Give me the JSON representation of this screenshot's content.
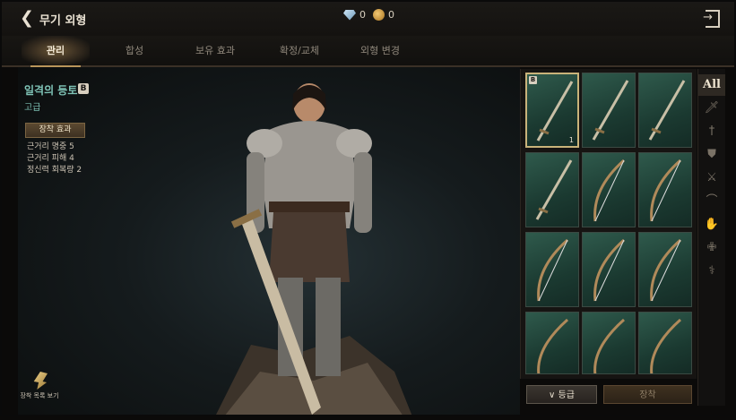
{
  "header": {
    "back_icon": "chevron-left-icon",
    "title": "무기 외형",
    "gem_count": "0",
    "coin_count": "0",
    "exit_icon": "exit-icon"
  },
  "tabs": [
    {
      "label": "관리",
      "active": true
    },
    {
      "label": "합성",
      "active": false
    },
    {
      "label": "보유 효과",
      "active": false
    },
    {
      "label": "확정/교체",
      "active": false
    },
    {
      "label": "외형 변경",
      "active": false
    }
  ],
  "item": {
    "name": "일격의 등토",
    "grade_badge": "B",
    "grade": "고급",
    "equip_effect_label": "장착 효과",
    "stats": [
      "근거리 명중 5",
      "근거리 피해 4",
      "정신력 회복량 2"
    ]
  },
  "gallery": {
    "label": "장착 목록 보기"
  },
  "grid": {
    "slots": [
      {
        "weapon": "sword",
        "selected": true,
        "badge": "B",
        "count": "1"
      },
      {
        "weapon": "sword",
        "selected": false
      },
      {
        "weapon": "sword",
        "selected": false
      },
      {
        "weapon": "sword",
        "selected": false
      },
      {
        "weapon": "bow",
        "selected": false
      },
      {
        "weapon": "bow",
        "selected": false
      },
      {
        "weapon": "bow",
        "selected": false
      },
      {
        "weapon": "bow",
        "selected": false
      },
      {
        "weapon": "bow",
        "selected": false
      },
      {
        "weapon": "bow",
        "selected": false
      },
      {
        "weapon": "bow",
        "selected": false
      },
      {
        "weapon": "bow",
        "selected": false
      }
    ]
  },
  "filters": [
    {
      "label": "All",
      "icon": "all-label",
      "active": true
    },
    {
      "label": "",
      "icon": "dagger-icon",
      "active": false
    },
    {
      "label": "",
      "icon": "sword-icon",
      "active": false
    },
    {
      "label": "",
      "icon": "shield-icon",
      "active": false
    },
    {
      "label": "",
      "icon": "crossed-swords-icon",
      "active": false
    },
    {
      "label": "",
      "icon": "bow-icon",
      "active": false
    },
    {
      "label": "",
      "icon": "gauntlet-icon",
      "active": false
    },
    {
      "label": "",
      "icon": "orb-staff-icon",
      "active": false
    },
    {
      "label": "",
      "icon": "wand-icon",
      "active": false
    }
  ],
  "buttons": {
    "grade_sort": "∨ 등급",
    "equip": "장착"
  },
  "colors": {
    "accent_gold": "#b9955a",
    "item_name": "#7fc3b6",
    "slot_bg": "#2f5a4c"
  }
}
